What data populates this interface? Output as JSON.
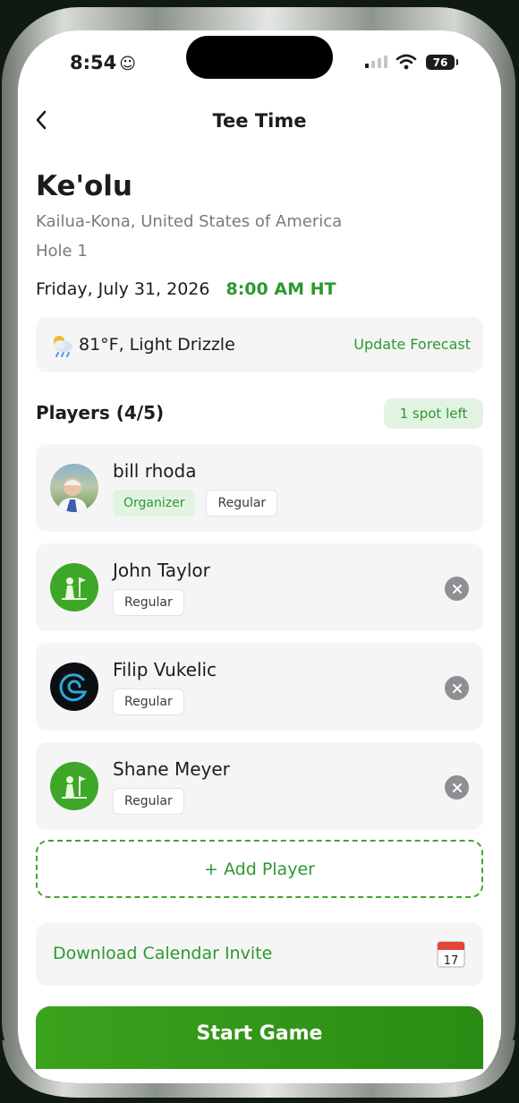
{
  "status_bar": {
    "time": "8:54",
    "battery": "76"
  },
  "header": {
    "title": "Tee Time"
  },
  "course": {
    "name": "Ke'olu",
    "location": "Kailua-Kona, United States of America",
    "hole": "Hole 1",
    "date": "Friday, July 31, 2026",
    "time": "8:00 AM HT"
  },
  "weather": {
    "summary": "81°F, Light Drizzle",
    "update_label": "Update Forecast"
  },
  "players": {
    "title": "Players (4/5)",
    "spots_badge": "1 spot left",
    "list": [
      {
        "name": "bill rhoda",
        "tags": [
          "Organizer",
          "Regular"
        ]
      },
      {
        "name": "John Taylor",
        "tags": [
          "Regular"
        ]
      },
      {
        "name": "Filip Vukelic",
        "tags": [
          "Regular"
        ]
      },
      {
        "name": "Shane Meyer",
        "tags": [
          "Regular"
        ]
      }
    ]
  },
  "actions": {
    "add_player": "+ Add Player",
    "calendar_invite": "Download Calendar Invite",
    "calendar_day": "17",
    "start_game": "Start Game"
  },
  "colors": {
    "accent": "#2b9a2e",
    "badge_bg": "#e3f3e3",
    "card_bg": "#f5f5f6"
  }
}
